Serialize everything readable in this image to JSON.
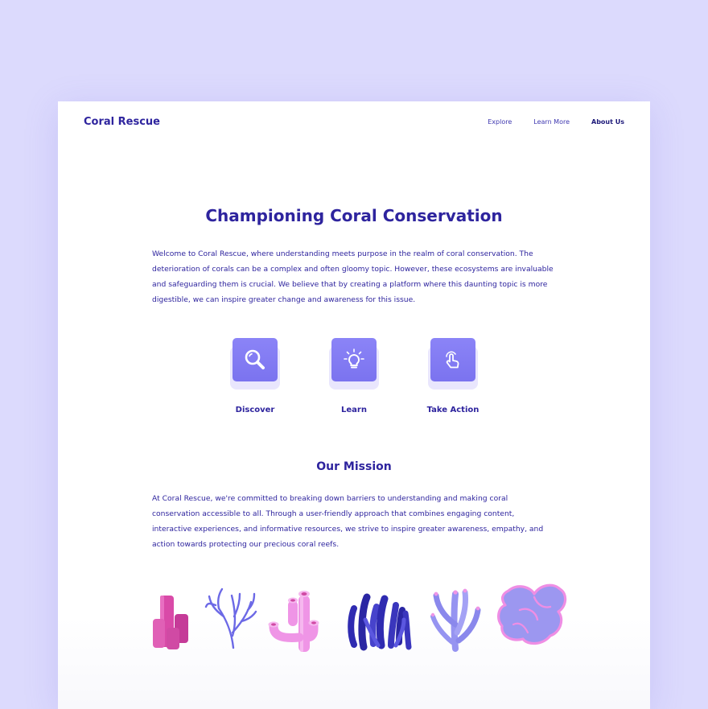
{
  "header": {
    "logo": "Coral Rescue",
    "nav": [
      "Explore",
      "Learn More",
      "About Us"
    ],
    "active_nav": "About Us"
  },
  "hero": {
    "title": "Championing Coral Conservation",
    "intro_lines": [
      "Welcome to Coral Rescue, where understanding meets purpose in the realm of coral conservation.  The",
      "deterioration of corals can be a complex and often gloomy topic. However, these ecosystems are invaluable",
      "and safeguarding them is crucial. We believe that by creating a platform where this daunting topic is more",
      "digestible, we can inspire greater change and awareness for this issue."
    ]
  },
  "features": [
    {
      "label": "Discover",
      "icon": "magnifier-icon"
    },
    {
      "label": "Learn",
      "icon": "lightbulb-icon"
    },
    {
      "label": "Take Action",
      "icon": "pointer-hand-icon"
    }
  ],
  "mission": {
    "title": "Our Mission",
    "lines": [
      "At Coral Rescue, we're committed to breaking down barriers to understanding and making coral",
      "conservation accessible to all. Through a user-friendly approach that combines engaging content,",
      "interactive experiences, and informative resources, we strive to inspire greater awareness, empathy, and",
      "action towards protecting our precious coral reefs."
    ]
  },
  "corals": [
    "pink-tube-coral-icon",
    "blue-branch-coral-icon",
    "pink-pipe-coral-icon",
    "navy-finger-coral-icon",
    "lavender-staghorn-coral-icon",
    "purple-plate-coral-icon"
  ],
  "colors": {
    "background": "#dcdafd",
    "card": "#ffffff",
    "primary_text": "#2e249e",
    "icon_tile": "#7b73ef",
    "icon_tile_base": "#e9e6fd",
    "coral_pink": "#d94aa8",
    "coral_light_pink": "#ef95e6",
    "coral_blue": "#6c69e6",
    "coral_navy": "#2f2bb1",
    "coral_lavender": "#9694f1"
  }
}
